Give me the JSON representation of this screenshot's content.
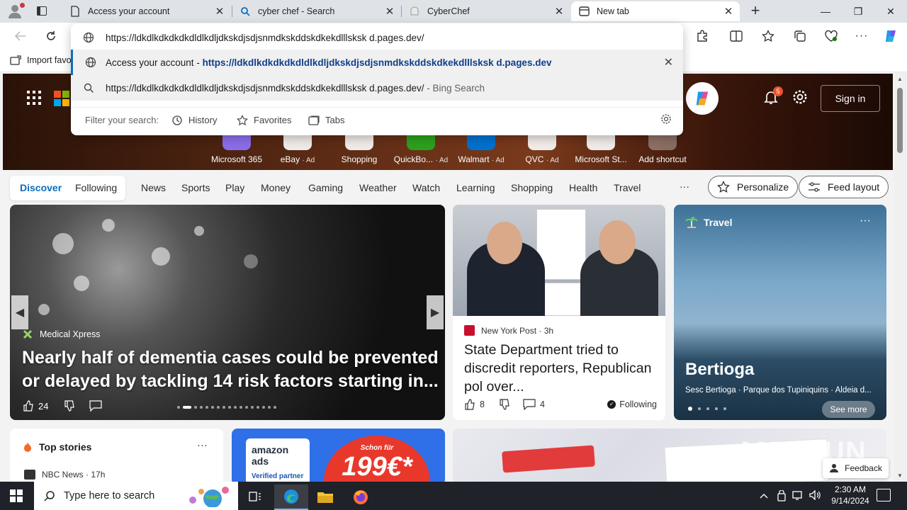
{
  "browser": {
    "tabs": [
      {
        "title": "Access your account",
        "active": false
      },
      {
        "title": "cyber chef - Search",
        "active": false
      },
      {
        "title": "CyberChef",
        "active": false
      },
      {
        "title": "New tab",
        "active": true
      }
    ],
    "close_glyph": "✕",
    "new_tab_glyph": "+",
    "window": {
      "minimize": "—",
      "maximize": "❐",
      "close": "✕"
    },
    "favorites_bar": {
      "import_label": "Import favo"
    }
  },
  "omnibox": {
    "typed_url": "https://ldkdlkdkdkdkdldlkdljdkskdjsdjsnmdkskddskdkekdlllsksk d.pages.dev/",
    "suggestion": {
      "title": "Access your account",
      "separator": " - ",
      "url": "https://ldkdlkdkdkdkdldlkdljdkskdjsdjsnmdkskddskdkekdlllsksk d.pages.dev"
    },
    "bing": {
      "query": "https://ldkdlkdkdkdkdldlkdljdkskdjsdjsnmdkskddskdkekdlllsksk d.pages.dev/",
      "suffix": " - Bing Search"
    },
    "filter": {
      "label": "Filter your search:",
      "history": "History",
      "favorites": "Favorites",
      "tabs": "Tabs"
    }
  },
  "newtab": {
    "signin": "Sign in",
    "notification_count": "5",
    "quick_links": [
      {
        "label": "Microsoft 365",
        "ad": ""
      },
      {
        "label": "eBay",
        "ad": "· Ad"
      },
      {
        "label": "Shopping",
        "ad": ""
      },
      {
        "label": "QuickBo...",
        "ad": "· Ad"
      },
      {
        "label": "Walmart",
        "ad": "· Ad"
      },
      {
        "label": "QVC",
        "ad": "· Ad"
      },
      {
        "label": "Microsoft St...",
        "ad": ""
      },
      {
        "label": "Add shortcut",
        "ad": ""
      }
    ],
    "nav": {
      "discover": "Discover",
      "following": "Following",
      "items": [
        "News",
        "Sports",
        "Play",
        "Money",
        "Gaming",
        "Weather",
        "Watch",
        "Learning",
        "Shopping",
        "Health",
        "Travel"
      ],
      "more": "···",
      "personalize": "Personalize",
      "feed_layout": "Feed layout"
    },
    "main_story": {
      "source": "Medical Xpress",
      "title": "Nearly half of dementia cases could be prevented or delayed by tackling 14 risk factors starting in...",
      "likes": "24"
    },
    "news_story": {
      "source": "New York Post",
      "age": "· 3h",
      "title": "State Department tried to discredit reporters, Republican pol over...",
      "likes": "8",
      "comments": "4",
      "following": "Following"
    },
    "travel": {
      "heading": "Travel",
      "more": "···",
      "title": "Bertioga",
      "subtitle": "Sesc Bertioga · Parque dos Tupiniquins · Aldeia d...",
      "see_more": "See more"
    },
    "top_stories": {
      "heading": "Top stories",
      "more": "···",
      "source": "NBC News · 17h"
    },
    "ad": {
      "brand": "amazon ads",
      "badge": "Verified partner",
      "promo_top": "Schon für",
      "promo_price": "199€*"
    },
    "feedback": "Feedback",
    "watermark": "ANY.RUN"
  },
  "taskbar": {
    "search_placeholder": "Type here to search",
    "time": "2:30 AM",
    "date": "9/14/2024"
  },
  "colors": {
    "accent": "#0f6cbd",
    "taskbar": "#1f2229",
    "notification_badge": "#e8552e"
  }
}
